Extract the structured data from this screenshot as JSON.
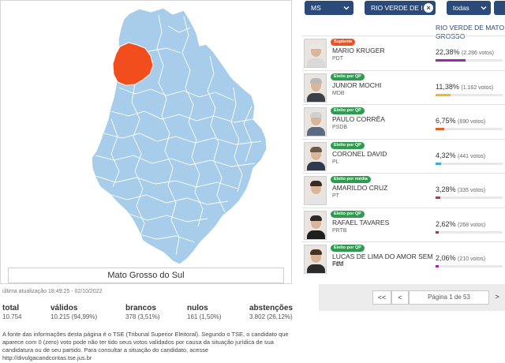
{
  "map": {
    "state_label": "Mato Grosso do Sul",
    "fill_color": "#a7cdea",
    "border_color": "#ffffff",
    "highlight_color": "#f14d1d"
  },
  "updated_text": "última atualização 18:49:25 - 02/10/2022",
  "stats": {
    "total": {
      "label": "total",
      "value": "10.754"
    },
    "validos": {
      "label": "válidos",
      "value": "10.215 (94,99%)"
    },
    "brancos": {
      "label": "brancos",
      "value": "378 (3,51%)"
    },
    "nulos": {
      "label": "nulos",
      "value": "161 (1,50%)"
    },
    "abstencoes": {
      "label": "abstenções",
      "value": "3.802 (26,12%)"
    }
  },
  "footnote": "A fonte das informações desta página é o TSE (Tribunal Superior Eleitoral). Segundo o TSE, o candidato que aparece com 0 (zero) voto pode não ter tido seus votos validados por causa da situação jurídica de sua candidatura ou de seu partido. Para consultar a situação do candidato, acesse http://divulgacandcontas.tse.jus.br",
  "filters": {
    "state": "MS",
    "city": "RIO VERDE DE I",
    "scope": "todas"
  },
  "column_header": "RIO VERDE DE MATO GROSSO",
  "candidates": [
    {
      "badge": "Suplente",
      "badge_color": "#e7542a",
      "name": "MARIO KRUGER",
      "party": "PDT",
      "pct": "22,38%",
      "votes": "(2.286 votos)",
      "share": 22.38,
      "bar_color": "#9c27b0",
      "shirt": "#d9d9d9",
      "hair": "#e8e8e8"
    },
    {
      "badge": "Eleito por QP",
      "badge_color": "#2e9b4f",
      "name": "JUNIOR MOCHI",
      "party": "MDB",
      "pct": "11,38%",
      "votes": "(1.162 votos)",
      "share": 11.38,
      "bar_color": "#f2b632",
      "shirt": "#3a3f4a",
      "hair": "#b9b9b9"
    },
    {
      "badge": "Eleito por QP",
      "badge_color": "#2e9b4f",
      "name": "PAULO CORRÊA",
      "party": "PSDB",
      "pct": "6,75%",
      "votes": "(690 votos)",
      "share": 6.75,
      "bar_color": "#e0602a",
      "shirt": "#5a6b86",
      "hair": "#cfcfcf"
    },
    {
      "badge": "Eleito por QP",
      "badge_color": "#2e9b4f",
      "name": "CORONEL DAVID",
      "party": "PL",
      "pct": "4,32%",
      "votes": "(441 votos)",
      "share": 4.32,
      "bar_color": "#4aa3d9",
      "shirt": "#2e3a50",
      "hair": "#6a5a4a"
    },
    {
      "badge": "Eleito por média",
      "badge_color": "#2e9b4f",
      "name": "AMARILDO CRUZ",
      "party": "PT",
      "pct": "3,28%",
      "votes": "(335 votos)",
      "share": 3.28,
      "bar_color": "#d6293a",
      "shirt": "#e4e4e4",
      "hair": "#3a2a22"
    },
    {
      "badge": "Eleito por QP",
      "badge_color": "#2e9b4f",
      "name": "RAFAEL TAVARES",
      "party": "PRTB",
      "pct": "2,62%",
      "votes": "(268 votos)",
      "share": 2.62,
      "bar_color": "#c62828",
      "shirt": "#1f1f1f",
      "hair": "#2a2a2a"
    },
    {
      "badge": "Eleito por QP",
      "badge_color": "#2e9b4f",
      "name": "LUCAS DE LIMA DO AMOR SEM FIM",
      "party": "PDT",
      "pct": "2,06%",
      "votes": "(210 votos)",
      "share": 2.06,
      "bar_color": "#9c27b0",
      "shirt": "#2b2b2b",
      "hair": "#4a3222"
    }
  ],
  "pager": {
    "first": "<<",
    "prev": "<",
    "info": "Página 1 de 53",
    "next": ">"
  }
}
